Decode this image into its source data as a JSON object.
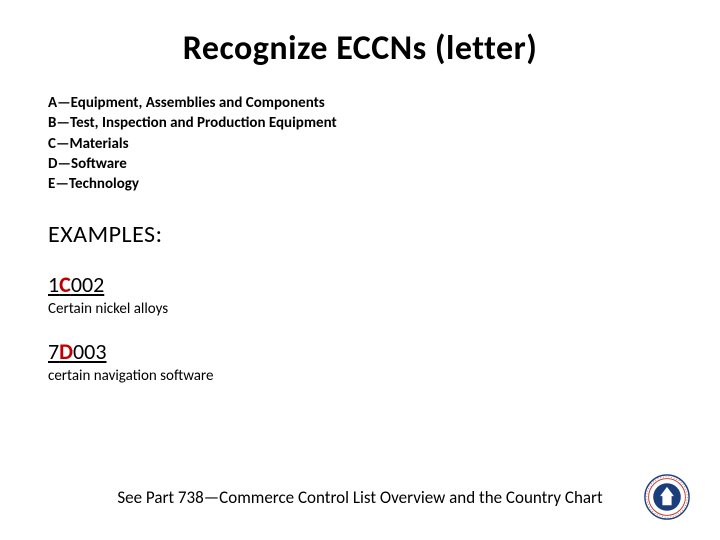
{
  "title": "Recognize ECCNs (letter)",
  "definitions": [
    {
      "label": "A—Equipment, Assemblies and Components"
    },
    {
      "label": "B—Test, Inspection and Production Equipment"
    },
    {
      "label": "C—Materials"
    },
    {
      "label": "D—Software"
    },
    {
      "label": "E—Technology"
    }
  ],
  "examples_heading": "EXAMPLES:",
  "examples": [
    {
      "pre": "1",
      "letter": "C",
      "post": "002",
      "desc": "Certain nickel alloys"
    },
    {
      "pre": "7",
      "letter": "D",
      "post": "003",
      "desc": "certain navigation software"
    }
  ],
  "footer": "See Part 738—Commerce Control List Overview and the Country Chart"
}
